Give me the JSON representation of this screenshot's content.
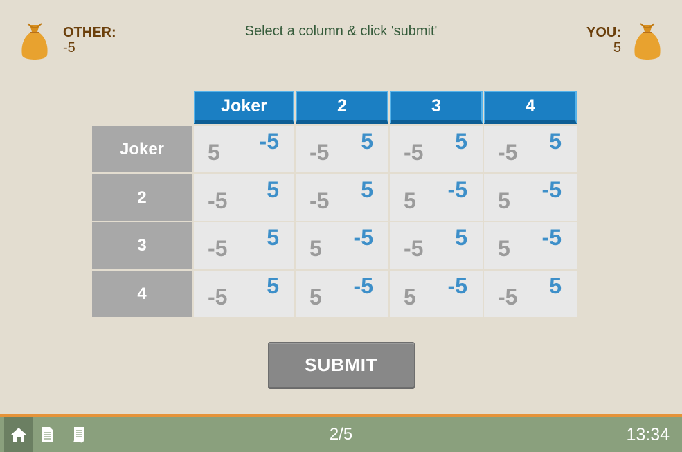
{
  "header": {
    "other_label": "OTHER:",
    "other_score": "-5",
    "you_label": "YOU:",
    "you_score": "5",
    "instruction": "Select a column & click 'submit'",
    "bag_icon": "money-bag-icon",
    "bag_color": "#e8a22f"
  },
  "matrix": {
    "columns": [
      "Joker",
      "2",
      "3",
      "4"
    ],
    "rows": [
      {
        "label": "Joker",
        "cells": [
          {
            "other": "5",
            "you": "-5"
          },
          {
            "other": "-5",
            "you": "5"
          },
          {
            "other": "-5",
            "you": "5"
          },
          {
            "other": "-5",
            "you": "5"
          }
        ]
      },
      {
        "label": "2",
        "cells": [
          {
            "other": "-5",
            "you": "5"
          },
          {
            "other": "-5",
            "you": "5"
          },
          {
            "other": "5",
            "you": "-5"
          },
          {
            "other": "5",
            "you": "-5"
          }
        ]
      },
      {
        "label": "3",
        "cells": [
          {
            "other": "-5",
            "you": "5"
          },
          {
            "other": "5",
            "you": "-5"
          },
          {
            "other": "-5",
            "you": "5"
          },
          {
            "other": "5",
            "you": "-5"
          }
        ]
      },
      {
        "label": "4",
        "cells": [
          {
            "other": "-5",
            "you": "5"
          },
          {
            "other": "5",
            "you": "-5"
          },
          {
            "other": "5",
            "you": "-5"
          },
          {
            "other": "-5",
            "you": "5"
          }
        ]
      }
    ]
  },
  "submit_label": "SUBMIT",
  "footer": {
    "progress": "2/5",
    "clock": "13:34",
    "icons": [
      "home-icon",
      "document-icon",
      "script-icon"
    ]
  },
  "colors": {
    "background": "#e3ddd0",
    "column_header": "#1b7fc3",
    "row_header": "#a8a8a8",
    "cell": "#e8e8e8",
    "other_value": "#9b9b9b",
    "you_value": "#3d8fc9",
    "footer": "#8aa07d",
    "footer_accent": "#e59339",
    "submit": "#888888"
  }
}
